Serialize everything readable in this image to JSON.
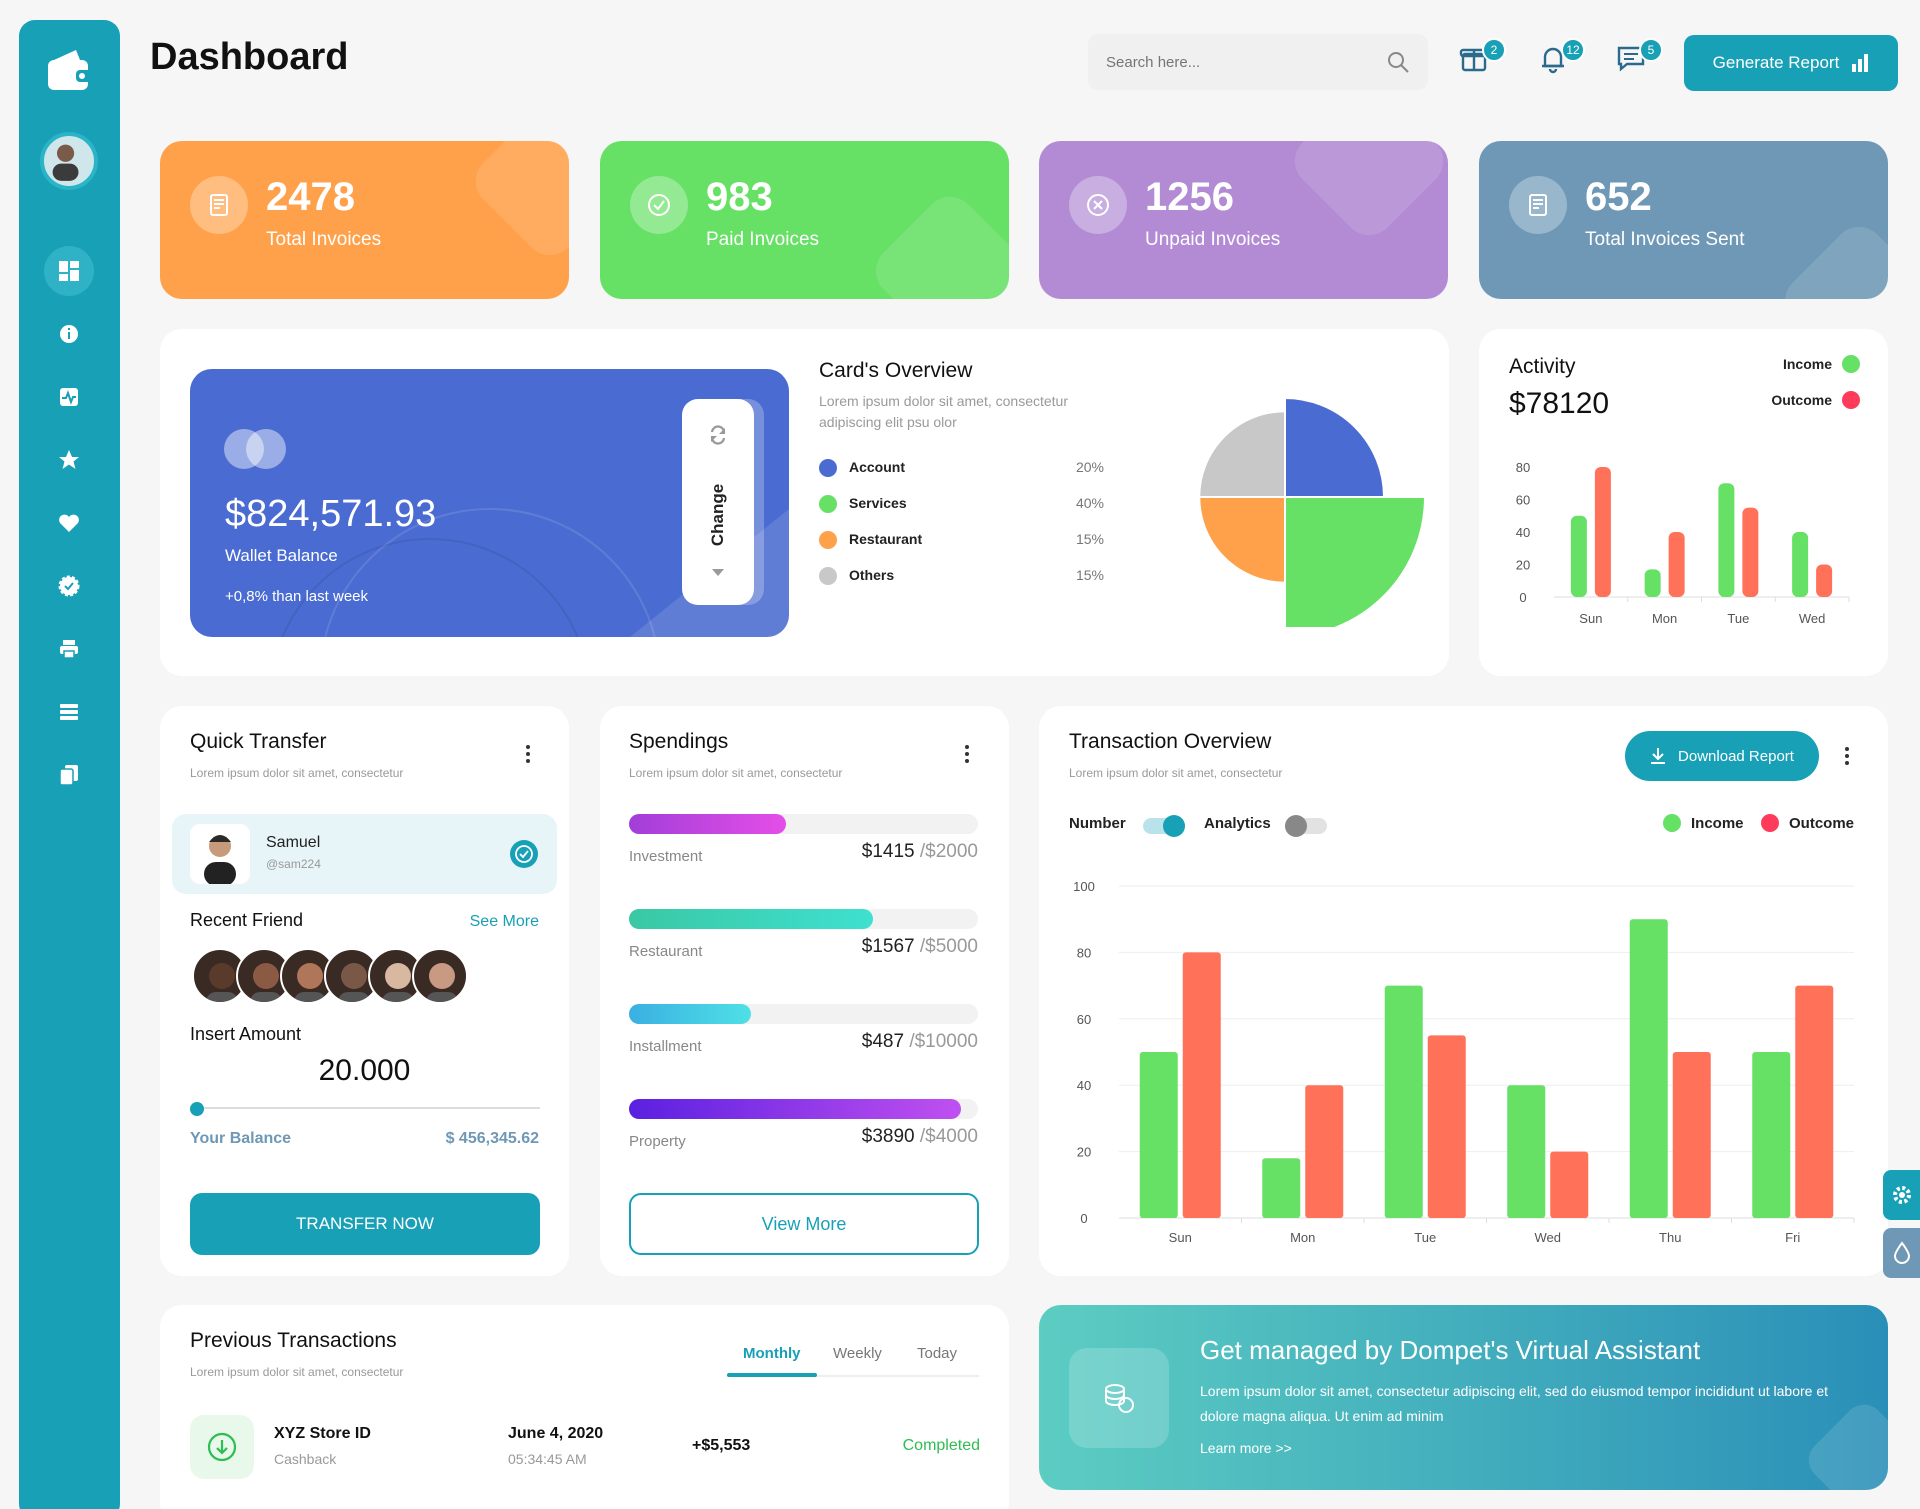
{
  "header": {
    "title": "Dashboard",
    "search_placeholder": "Search here...",
    "badges": {
      "gift": "2",
      "bell": "12",
      "chat": "5"
    },
    "generate_report": "Generate Report"
  },
  "sidebar": {
    "items": [
      {
        "icon": "dashboard-icon"
      },
      {
        "icon": "info-icon"
      },
      {
        "icon": "activity-icon"
      },
      {
        "icon": "star-icon"
      },
      {
        "icon": "heart-icon"
      },
      {
        "icon": "badge-check-icon"
      },
      {
        "icon": "printer-icon"
      },
      {
        "icon": "list-icon"
      },
      {
        "icon": "documents-icon"
      }
    ]
  },
  "stats": [
    {
      "value": "2478",
      "label": "Total Invoices",
      "color": "#ffa14a",
      "icon": "receipt-icon"
    },
    {
      "value": "983",
      "label": "Paid Invoices",
      "color": "#66e065",
      "icon": "check-circle-icon"
    },
    {
      "value": "1256",
      "label": "Unpaid Invoices",
      "color": "#b28bd4",
      "icon": "x-circle-icon"
    },
    {
      "value": "652",
      "label": "Total Invoices Sent",
      "color": "#6e98b6",
      "icon": "receipt-icon"
    }
  ],
  "wallet": {
    "balance": "$824,571.93",
    "label": "Wallet Balance",
    "change": "+0,8% than last week",
    "change_button": "Change"
  },
  "cards_overview": {
    "title": "Card's Overview",
    "subtitle": "Lorem ipsum dolor sit amet, consectetur adipiscing elit psu olor",
    "items": [
      {
        "name": "Account",
        "pct": "20%",
        "color": "#4a6bd1"
      },
      {
        "name": "Services",
        "pct": "40%",
        "color": "#66e065"
      },
      {
        "name": "Restaurant",
        "pct": "15%",
        "color": "#ffa14a"
      },
      {
        "name": "Others",
        "pct": "15%",
        "color": "#c8c8c8"
      }
    ]
  },
  "activity": {
    "title": "Activity",
    "amount": "$78120",
    "legend_income": "Income",
    "legend_outcome": "Outcome"
  },
  "quick_transfer": {
    "title": "Quick Transfer",
    "subtitle": "Lorem ipsum dolor sit amet, consectetur",
    "user_name": "Samuel",
    "user_handle": "@sam224",
    "recent_friend": "Recent Friend",
    "see_more": "See More",
    "insert_amount": "Insert Amount",
    "amount": "20.000",
    "your_balance": "Your Balance",
    "balance": "$ 456,345.62",
    "button": "TRANSFER NOW"
  },
  "spendings": {
    "title": "Spendings",
    "subtitle": "Lorem ipsum dolor sit amet, consectetur",
    "rows": [
      {
        "name": "Investment",
        "value": "$1415",
        "total": "/$2000",
        "fraction": 0.45
      },
      {
        "name": "Restaurant",
        "value": "$1567",
        "total": "/$5000",
        "fraction": 0.7
      },
      {
        "name": "Installment",
        "value": "$487",
        "total": "/$10000",
        "fraction": 0.35
      },
      {
        "name": "Property",
        "value": "$3890",
        "total": "/$4000",
        "fraction": 0.95
      }
    ],
    "button": "View More"
  },
  "transaction_overview": {
    "title": "Transaction Overview",
    "subtitle": "Lorem ipsum dolor sit amet, consectetur",
    "download": "Download Report",
    "toggle_number": "Number",
    "toggle_analytics": "Analytics",
    "legend_income": "Income",
    "legend_outcome": "Outcome"
  },
  "previous_transactions": {
    "title": "Previous Transactions",
    "subtitle": "Lorem ipsum dolor sit amet, consectetur",
    "tabs": [
      "Monthly",
      "Weekly",
      "Today"
    ],
    "rows": [
      {
        "name": "XYZ Store ID",
        "type": "Cashback",
        "date": "June 4, 2020",
        "time": "05:34:45 AM",
        "amount": "+$5,553",
        "status": "Completed"
      }
    ]
  },
  "promo": {
    "title": "Get managed by Dompet's Virtual Assistant",
    "text": "Lorem ipsum dolor sit amet, consectetur adipiscing elit, sed do eiusmod tempor incididunt ut labore et dolore magna aliqua. Ut enim ad minim",
    "link": "Learn more >>"
  },
  "chart_data": [
    {
      "type": "pie",
      "categories": [
        "Account",
        "Services",
        "Restaurant",
        "Others"
      ],
      "values": [
        20,
        40,
        15,
        15
      ],
      "colors": [
        "#4a6bd1",
        "#66e065",
        "#ffa14a",
        "#c8c8c8"
      ]
    },
    {
      "type": "bar",
      "categories": [
        "Sun",
        "Mon",
        "Tue",
        "Wed"
      ],
      "series": [
        {
          "name": "Income",
          "values": [
            50,
            17,
            70,
            40
          ],
          "color": "#66e065"
        },
        {
          "name": "Outcome",
          "values": [
            80,
            40,
            55,
            20
          ],
          "color": "#ff7158"
        }
      ],
      "ylim": [
        0,
        80
      ],
      "yticks": [
        0,
        20,
        40,
        60,
        80
      ]
    },
    {
      "type": "bar",
      "categories": [
        "Sun",
        "Mon",
        "Tue",
        "Wed",
        "Thu",
        "Fri"
      ],
      "series": [
        {
          "name": "Income",
          "values": [
            50,
            18,
            70,
            40,
            90,
            50
          ],
          "color": "#66e065"
        },
        {
          "name": "Outcome",
          "values": [
            80,
            40,
            55,
            20,
            50,
            70
          ],
          "color": "#ff7158"
        }
      ],
      "ylim": [
        0,
        100
      ],
      "yticks": [
        0,
        20,
        40,
        60,
        80,
        100
      ],
      "grid": true
    }
  ]
}
